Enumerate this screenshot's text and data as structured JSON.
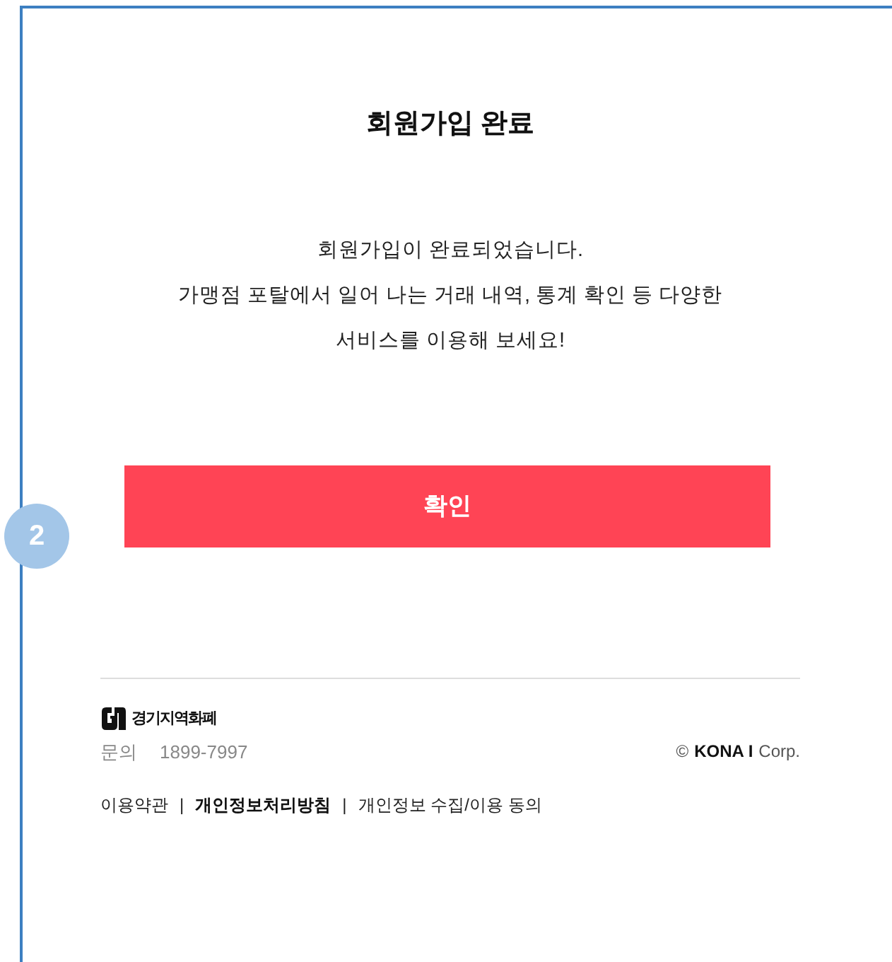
{
  "step_badge": "2",
  "title": "회원가입 완료",
  "message_lines": [
    "회원가입이 완료되었습니다.",
    "가맹점 포탈에서 일어 나는 거래 내역, 통계 확인 등 다양한",
    "서비스를 이용해 보세요!"
  ],
  "confirm_button": "확인",
  "footer": {
    "logo_text": "경기지역화폐",
    "contact_label": "문의",
    "contact_number": "1899-7997",
    "copyright_symbol": "©",
    "company_bold": "KONA I",
    "company_rest": "Corp.",
    "links": [
      {
        "label": "이용약관",
        "bold": false
      },
      {
        "label": "개인정보처리방침",
        "bold": true
      },
      {
        "label": "개인정보 수집/이용 동의",
        "bold": false
      }
    ],
    "separator": "|"
  }
}
